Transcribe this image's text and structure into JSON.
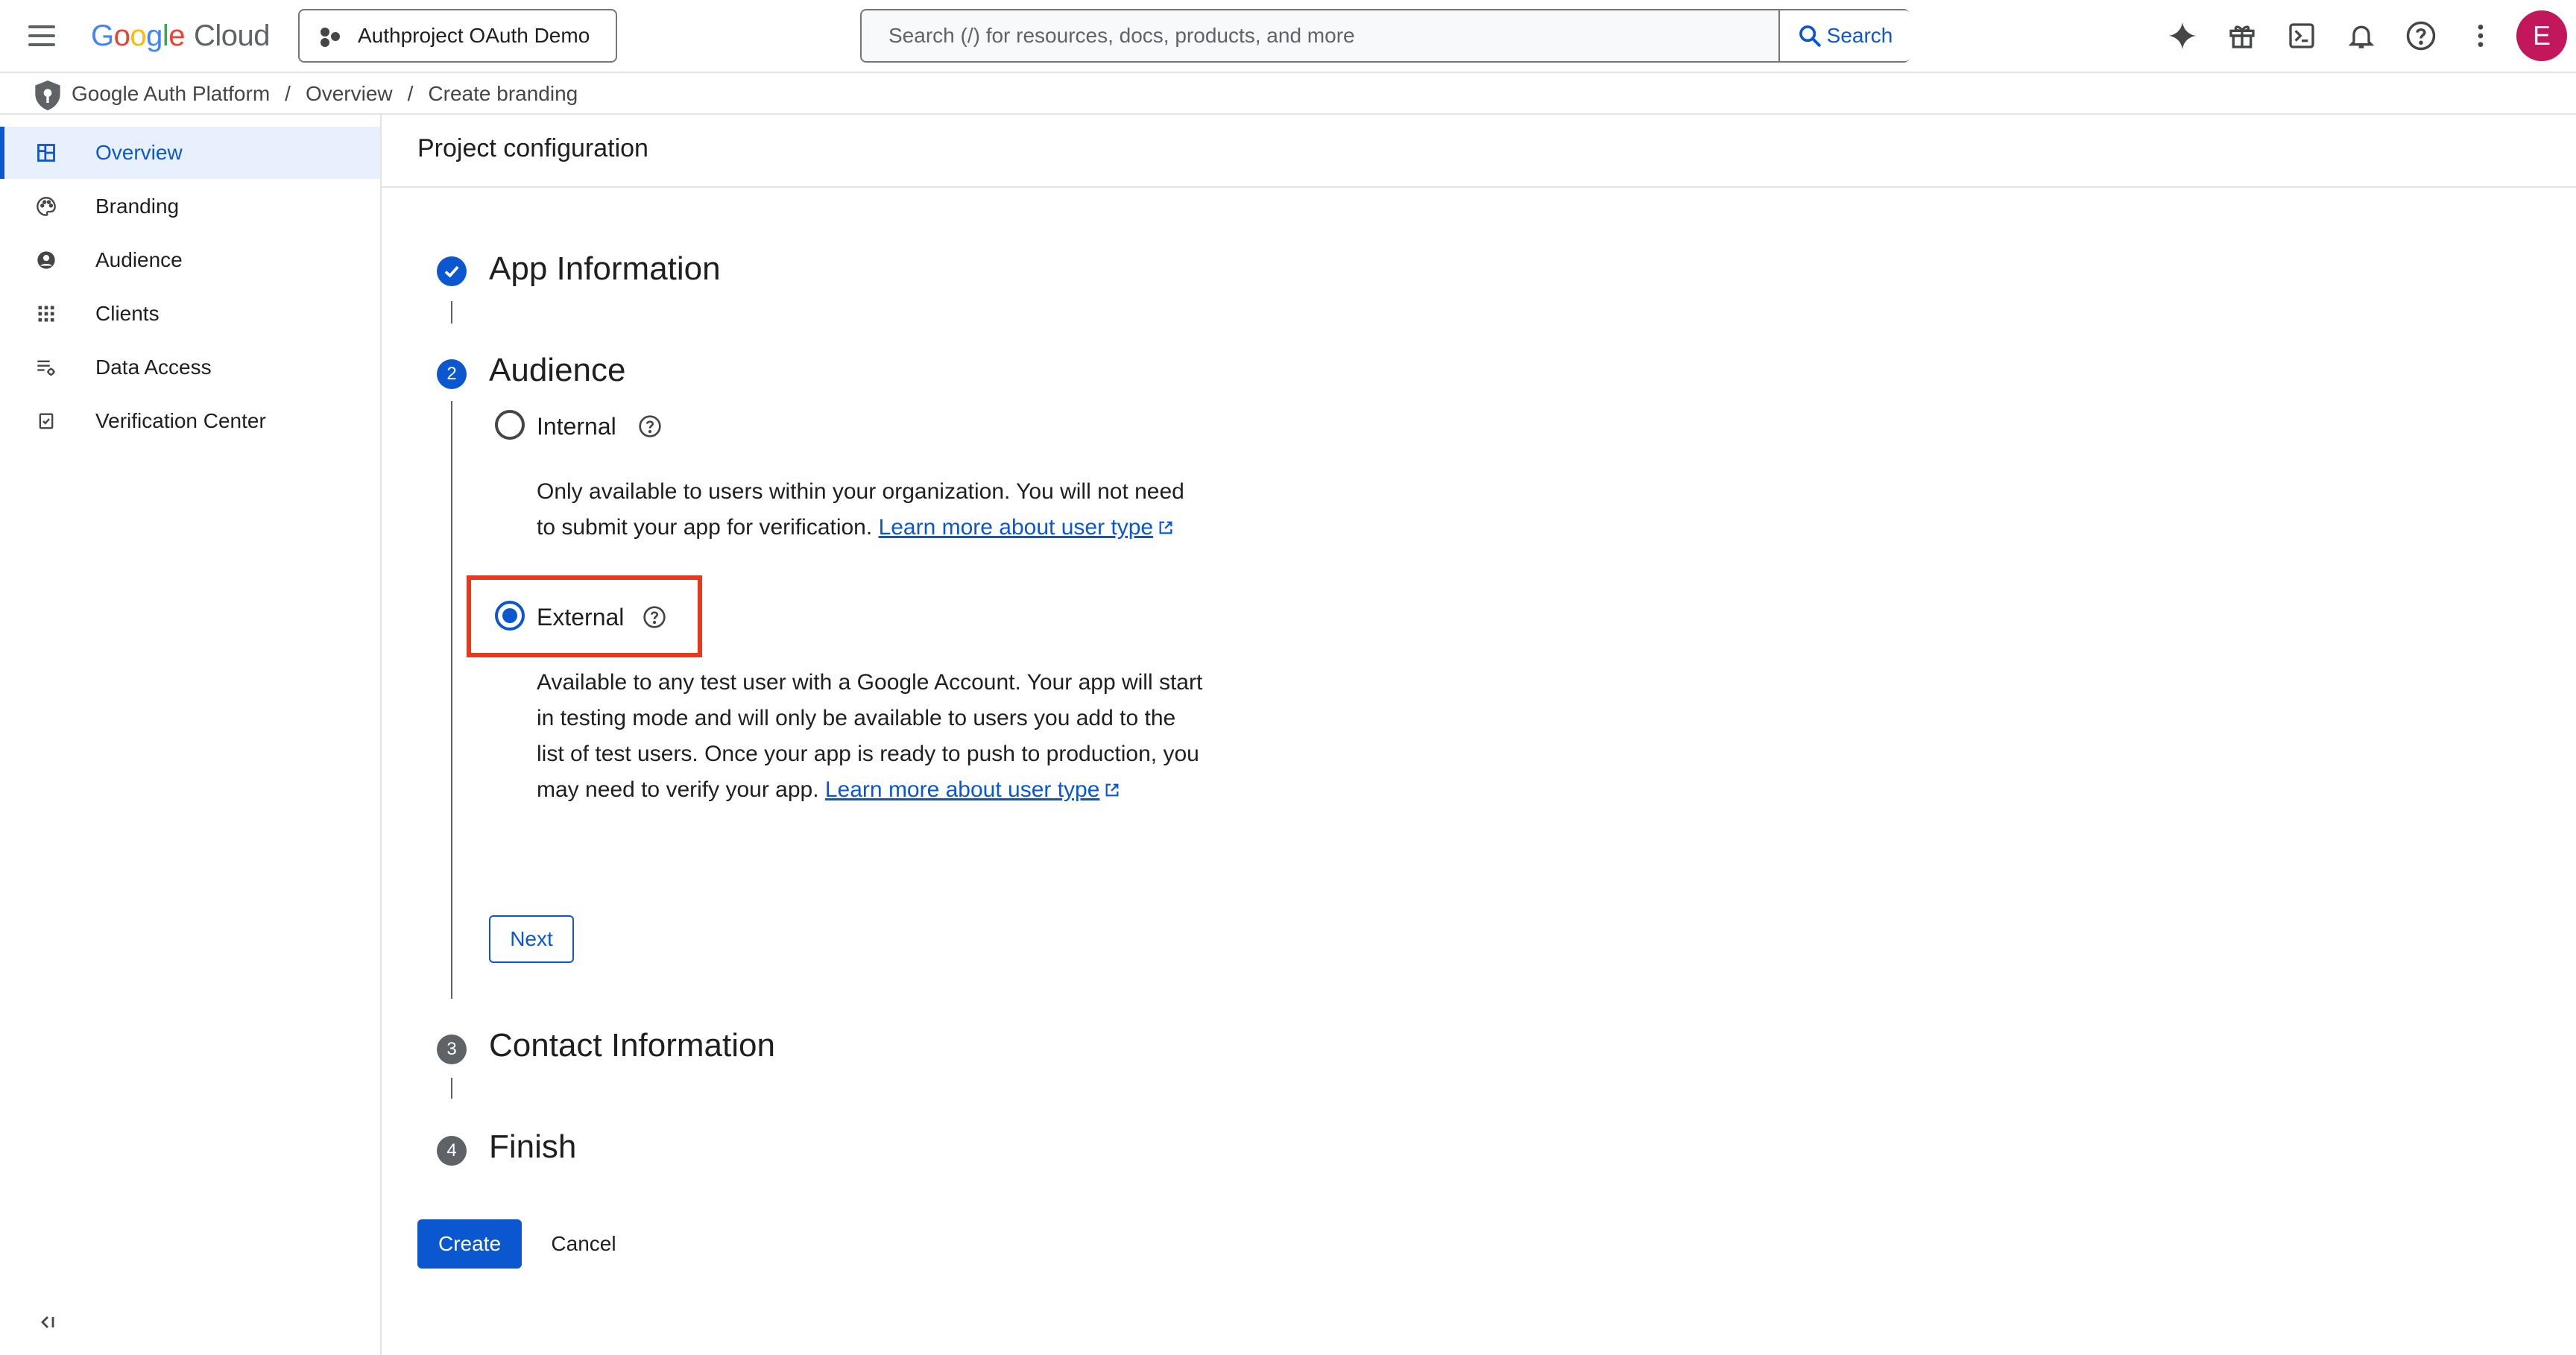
{
  "header": {
    "logo": {
      "google": "Google",
      "cloud": "Cloud"
    },
    "project_picker": {
      "label": "Authproject OAuth Demo",
      "icon": "hub-icon"
    },
    "search": {
      "placeholder": "Search (/) for resources, docs, products, and more",
      "value": "",
      "button_label": "Search"
    },
    "icons": [
      "gemini-sparkle-icon",
      "gift-icon",
      "cloud-shell-icon",
      "bell-icon",
      "help-icon",
      "more-vert-icon"
    ],
    "avatar_initial": "E",
    "colors": {
      "avatar": "#c2185b",
      "accent": "#0b57d0"
    }
  },
  "breadcrumb": {
    "items": [
      "Google Auth Platform",
      "Overview",
      "Create branding"
    ],
    "separator": "/"
  },
  "sidebar": {
    "items": [
      {
        "label": "Overview",
        "icon": "dashboard-icon",
        "active": true
      },
      {
        "label": "Branding",
        "icon": "palette-icon",
        "active": false
      },
      {
        "label": "Audience",
        "icon": "account-circle-icon",
        "active": false
      },
      {
        "label": "Clients",
        "icon": "grid-icon",
        "active": false
      },
      {
        "label": "Data Access",
        "icon": "data-settings-icon",
        "active": false
      },
      {
        "label": "Verification Center",
        "icon": "verified-check-icon",
        "active": false
      }
    ],
    "collapse_label": "<|"
  },
  "main": {
    "title": "Project configuration",
    "steps": [
      {
        "number": "1",
        "title": "App Information",
        "state": "complete"
      },
      {
        "number": "2",
        "title": "Audience",
        "state": "active"
      },
      {
        "number": "3",
        "title": "Contact Information",
        "state": "pending"
      },
      {
        "number": "4",
        "title": "Finish",
        "state": "pending"
      }
    ],
    "audience": {
      "internal": {
        "label": "Internal",
        "checked": false,
        "description": "Only available to users within your organization. You will not need to submit your app for verification.",
        "link": "Learn more about user type"
      },
      "external": {
        "label": "External",
        "checked": true,
        "description": "Available to any test user with a Google Account. Your app will start in testing mode and will only be available to users you add to the list of test users. Once your app is ready to push to production, you may need to verify your app.",
        "link": "Learn more about user type"
      },
      "next_label": "Next"
    },
    "actions": {
      "create_label": "Create",
      "cancel_label": "Cancel"
    },
    "highlight_color": "#e8391e"
  }
}
